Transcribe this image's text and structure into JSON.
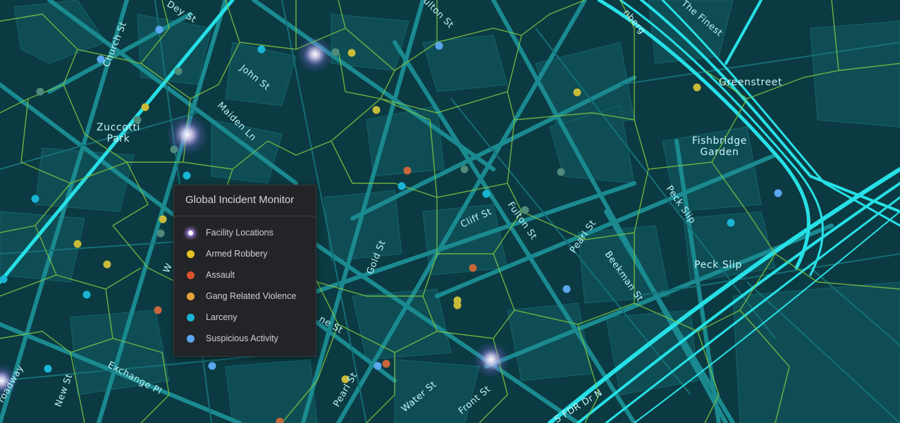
{
  "legend": {
    "title": "Global Incident Monitor",
    "items": [
      {
        "label": "Facility Locations",
        "color": "#ffffff",
        "icon": "facility-glow-dot"
      },
      {
        "label": "Armed Robbery",
        "color": "#e6c323"
      },
      {
        "label": "Assault",
        "color": "#d9532c"
      },
      {
        "label": "Gang Related Violence",
        "color": "#e8a23c"
      },
      {
        "label": "Larceny",
        "color": "#19b5d6"
      },
      {
        "label": "Suspicious Activity",
        "color": "#5aa7ef"
      }
    ]
  },
  "map": {
    "background": "#0c3a42",
    "block_color": "#0f4d55",
    "road_color": "#1a8a90",
    "highway_color": "#26e0e6",
    "boundary_color": "#7cc441",
    "streets": {
      "dey_st": "Dey St",
      "church_st": "Church St",
      "john_st": "John St",
      "maiden_ln": "Maiden Ln",
      "fulton_st_top": "ulton St",
      "finest": "The Finest",
      "greenberg": "nberg",
      "cliff_st": "Cliff St",
      "fulton_st": "Fulton St",
      "pearl_st": "Pearl St",
      "peck_slip_st": "Peck Slip",
      "beekman_st": "Beekman St",
      "gold_st": "Gold St",
      "pine_st": "ne St",
      "pearl_st_2": "Pearl St",
      "water_st": "Water St",
      "front_st": "Front St",
      "fdr_dr": "S FDR Dr N",
      "exchange_pl": "Exchange Pl",
      "new_st": "New St",
      "broadway": "roadway",
      "w": "W"
    },
    "pois": {
      "zuccotti_1": "Zuccotti",
      "zuccotti_2": "Park",
      "greenstreet": "Greenstreet",
      "fishbridge_1": "Fishbridge",
      "fishbridge_2": "Garden",
      "peck_slip": "Peck Slip"
    }
  }
}
